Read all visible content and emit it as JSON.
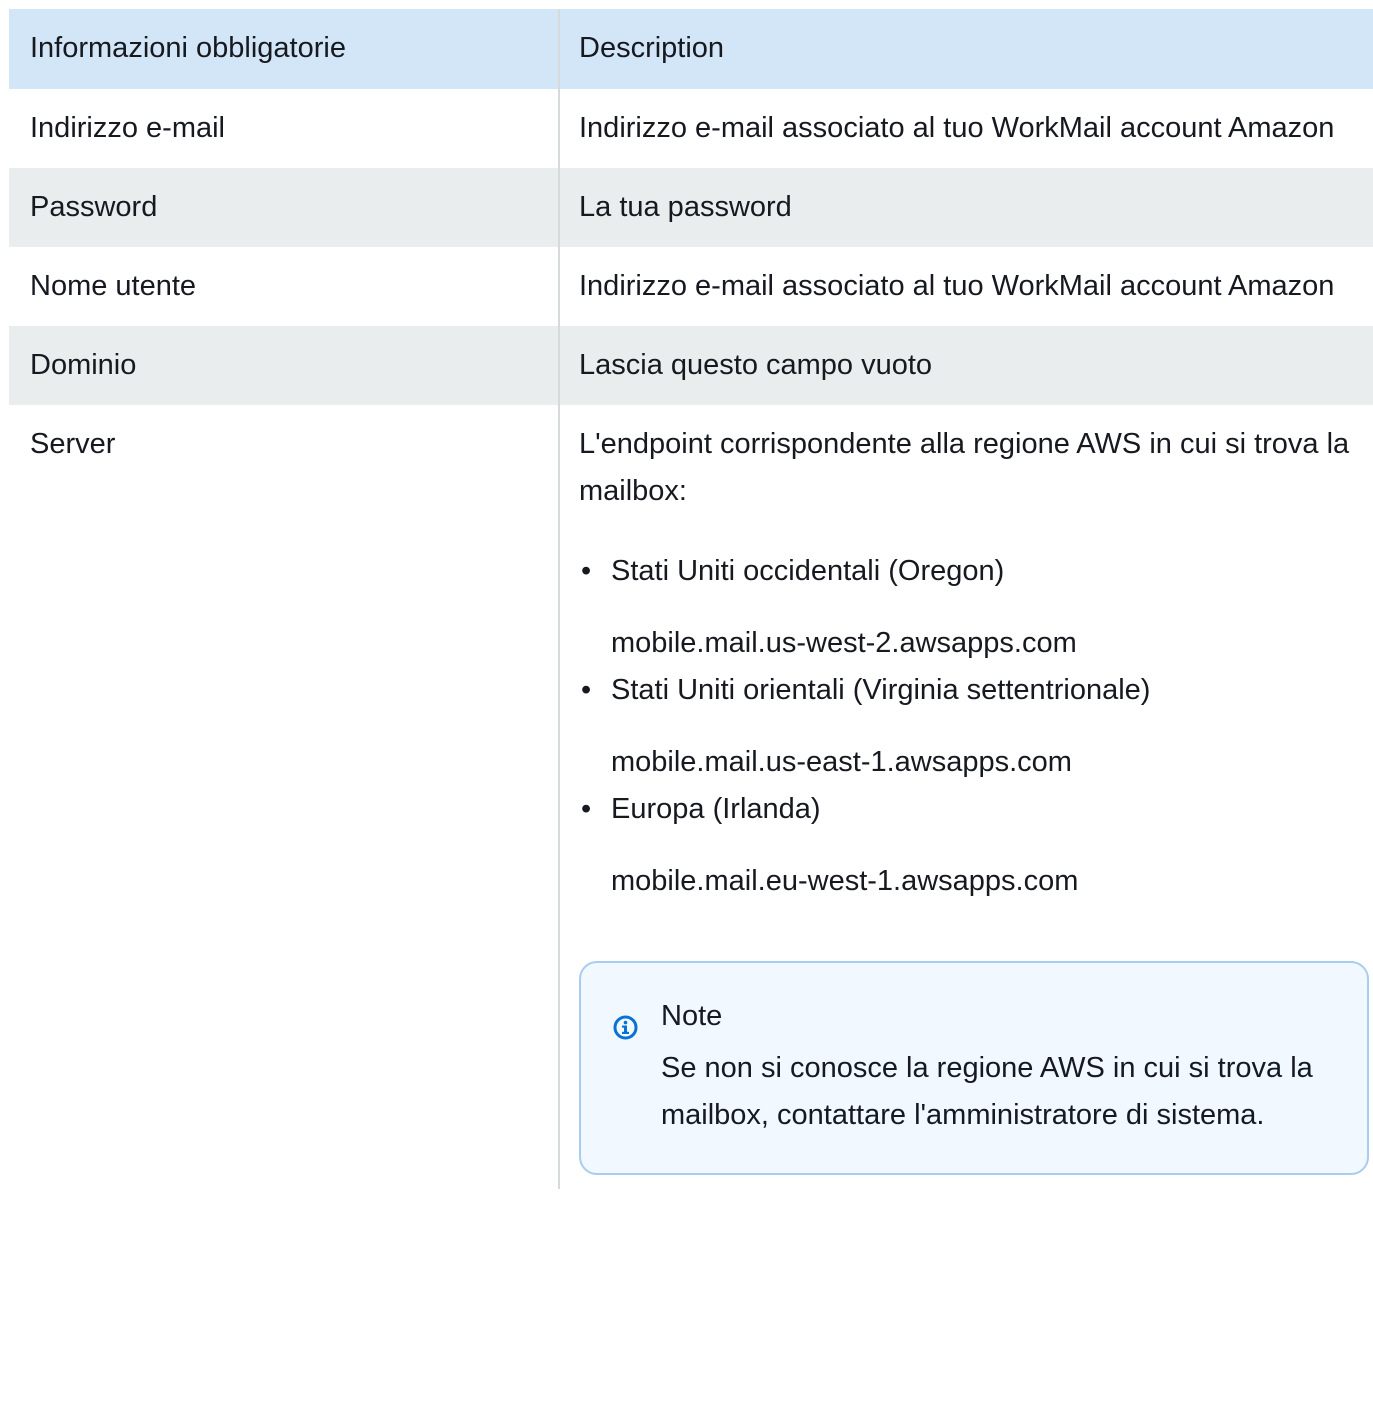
{
  "table": {
    "headers": [
      "Informazioni obbligatorie",
      "Description"
    ],
    "rows": [
      {
        "label": "Indirizzo e-mail",
        "description": "Indirizzo e-mail associato al tuo WorkMail account Amazon"
      },
      {
        "label": "Password",
        "description": "La tua password"
      },
      {
        "label": "Nome utente",
        "description": "Indirizzo e-mail associato al tuo WorkMail account Amazon"
      },
      {
        "label": "Dominio",
        "description": "Lascia questo campo vuoto"
      }
    ],
    "server": {
      "label": "Server",
      "intro": "L'endpoint corrispondente alla regione AWS in cui si trova la mailbox:",
      "regions": [
        {
          "name": "Stati Uniti occidentali (Oregon)",
          "endpoint": "mobile.mail.us-west-2.awsapps.com"
        },
        {
          "name": "Stati Uniti orientali (Virginia settentrionale)",
          "endpoint": "mobile.mail.us-east-1.awsapps.com"
        },
        {
          "name": "Europa (Irlanda)",
          "endpoint": "mobile.mail.eu-west-1.awsapps.com"
        }
      ],
      "note": {
        "title": "Note",
        "text": "Se non si conosce la regione AWS in cui si trova la mailbox, contattare l'amministratore di sistema.",
        "icon": "info-icon"
      }
    }
  },
  "colors": {
    "header_bg": "#d3e6f8",
    "stripe_bg": "#eaeded",
    "note_bg": "#f1f8ff",
    "note_border": "#a9cdee",
    "info_icon": "#0972d3"
  }
}
